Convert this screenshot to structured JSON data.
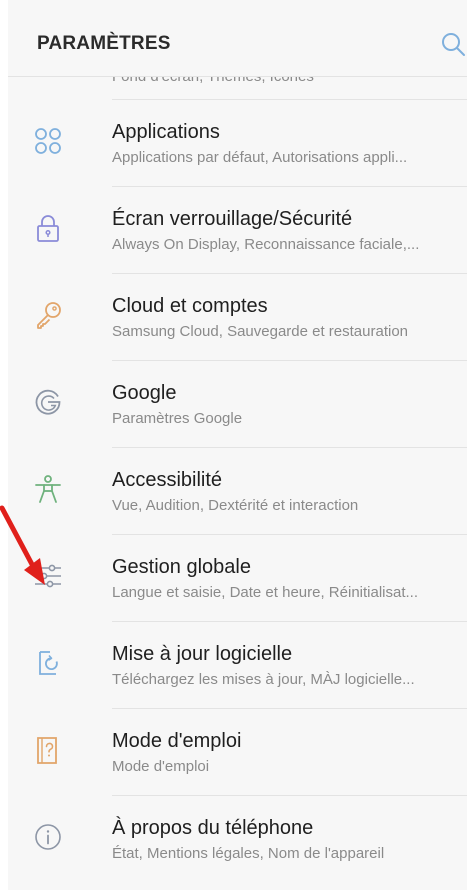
{
  "header": {
    "title": "PARAMÈTRES",
    "search_icon": "search-icon"
  },
  "partial_row": {
    "subtitle": "Fond d'écran, Thèmes, Icônes"
  },
  "colors": {
    "icon_blue": "#7fb0dd",
    "icon_purple": "#8a8bd8",
    "icon_orange": "#e2a56a",
    "icon_grey": "#8d96a6",
    "icon_green": "#6fb27d",
    "annotation_arrow": "#e0201b"
  },
  "items": [
    {
      "title": "Applications",
      "subtitle": "Applications par défaut, Autorisations appli...",
      "icon": "apps-grid-icon"
    },
    {
      "title": "Écran verrouillage/Sécurité",
      "subtitle": "Always On Display, Reconnaissance faciale,...",
      "icon": "lock-icon"
    },
    {
      "title": "Cloud et comptes",
      "subtitle": "Samsung Cloud, Sauvegarde et restauration",
      "icon": "key-icon"
    },
    {
      "title": "Google",
      "subtitle": "Paramètres Google",
      "icon": "google-icon"
    },
    {
      "title": "Accessibilité",
      "subtitle": "Vue, Audition, Dextérité et interaction",
      "icon": "accessibility-icon"
    },
    {
      "title": "Gestion globale",
      "subtitle": "Langue et saisie, Date et heure, Réinitialisat...",
      "icon": "sliders-icon"
    },
    {
      "title": "Mise à jour logicielle",
      "subtitle": "Téléchargez les mises à jour, MÀJ logicielle...",
      "icon": "software-update-icon"
    },
    {
      "title": "Mode d'emploi",
      "subtitle": "Mode d'emploi",
      "icon": "user-manual-icon"
    },
    {
      "title": "À propos du téléphone",
      "subtitle": "État, Mentions légales, Nom de l'appareil",
      "icon": "info-icon"
    }
  ]
}
